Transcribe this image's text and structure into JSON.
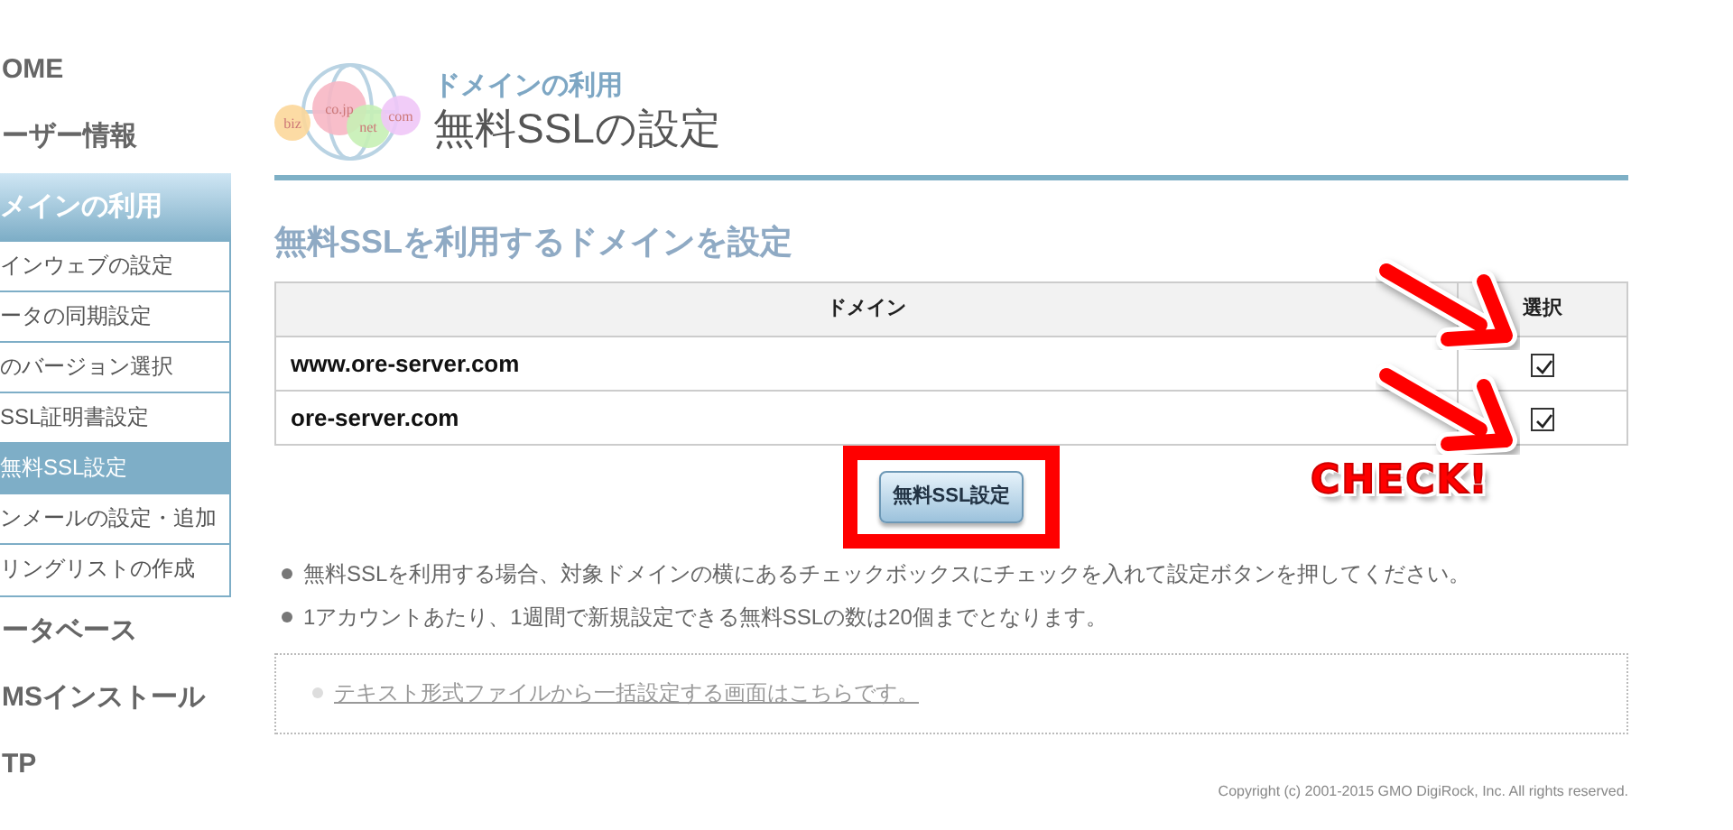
{
  "sidebar": {
    "items": [
      {
        "label": "OME",
        "kind": "top",
        "selected": false
      },
      {
        "label": "ーザー情報",
        "kind": "top",
        "selected": false
      },
      {
        "label": "メインの利用",
        "kind": "section",
        "selected": true,
        "children": [
          {
            "label": "インウェブの設定",
            "selected": false
          },
          {
            "label": "ータの同期設定",
            "selected": false
          },
          {
            "label": "のバージョン選択",
            "selected": false
          },
          {
            "label": "SSL証明書設定",
            "selected": false
          },
          {
            "label": "無料SSL設定",
            "selected": true
          },
          {
            "label": "ンメールの設定・追加",
            "selected": false
          },
          {
            "label": "リングリストの作成",
            "selected": false
          }
        ]
      },
      {
        "label": "ータベース",
        "kind": "top",
        "selected": false
      },
      {
        "label": "MSインストール",
        "kind": "top",
        "selected": false
      },
      {
        "label": "TP",
        "kind": "top",
        "selected": false
      }
    ]
  },
  "header": {
    "logo_labels": [
      "biz",
      "co.jp",
      "net",
      "com"
    ],
    "category": "ドメインの利用",
    "title": "無料SSLの設定"
  },
  "section_title": "無料SSLを利用するドメインを設定",
  "table": {
    "columns": [
      "ドメイン",
      "選択"
    ],
    "rows": [
      {
        "domain": "www.ore-server.com",
        "checked": true,
        "arrow": true
      },
      {
        "domain": "ore-server.com",
        "checked": true,
        "arrow": true
      }
    ]
  },
  "submit_button": {
    "label": "無料SSL設定",
    "highlighted": true
  },
  "notes": [
    "無料SSLを利用する場合、対象ドメインの横にあるチェックボックスにチェックを入れて設定ボタンを押してください。",
    "1アカウントあたり、1週間で新規設定できる無料SSLの数は20個までとなります。"
  ],
  "bulk_link": "テキスト形式ファイルから一括設定する画面はこちらです。",
  "copyright": "Copyright (c) 2001-2015 GMO DigiRock, Inc. All rights reserved.",
  "annotation": {
    "text": "CHECK!"
  }
}
